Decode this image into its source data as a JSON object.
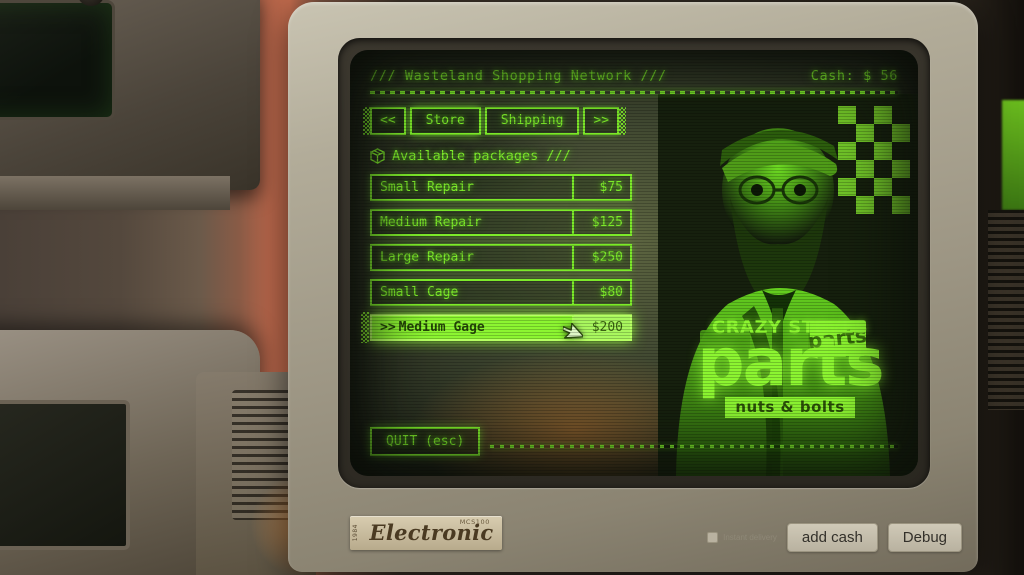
{
  "screen": {
    "header": {
      "title": "/// Wasteland Shopping Network ///",
      "cash_label": "Cash: $ 56"
    },
    "tabs": {
      "prev_arrow": "<<",
      "next_arrow": ">>",
      "items": [
        {
          "label": "Store",
          "active": true
        },
        {
          "label": "Shipping",
          "active": false
        }
      ]
    },
    "section": {
      "icon": "package-box-icon",
      "title": "Available packages ///"
    },
    "packages": [
      {
        "name": "Small Repair",
        "price": "$75",
        "selected": false,
        "marker": ""
      },
      {
        "name": "Medium Repair",
        "price": "$125",
        "selected": false,
        "marker": ""
      },
      {
        "name": "Large Repair",
        "price": "$250",
        "selected": false,
        "marker": ""
      },
      {
        "name": "Small Cage",
        "price": "$80",
        "selected": false,
        "marker": ""
      },
      {
        "name": "Medium Gage",
        "price": "$200",
        "selected": true,
        "marker": ">>"
      }
    ],
    "quit_button": "QUIT (esc)",
    "logo": {
      "top": "CRAZY STEVES",
      "main": "parts",
      "sub": "nuts & bolts"
    }
  },
  "bezel": {
    "brand_side": "1984",
    "brand_model": "MCS100",
    "brand_name": "Electronic"
  },
  "dev_bar": {
    "instant_delivery_label": "Instant delivery",
    "instant_delivery_checked": false,
    "add_cash_label": "add cash",
    "debug_label": "Debug"
  },
  "colors": {
    "phosphor_green": "#7dea2a",
    "bright_green": "#8cf531",
    "screen_bg": "#3e4630",
    "bezel": "#b2ac99"
  }
}
